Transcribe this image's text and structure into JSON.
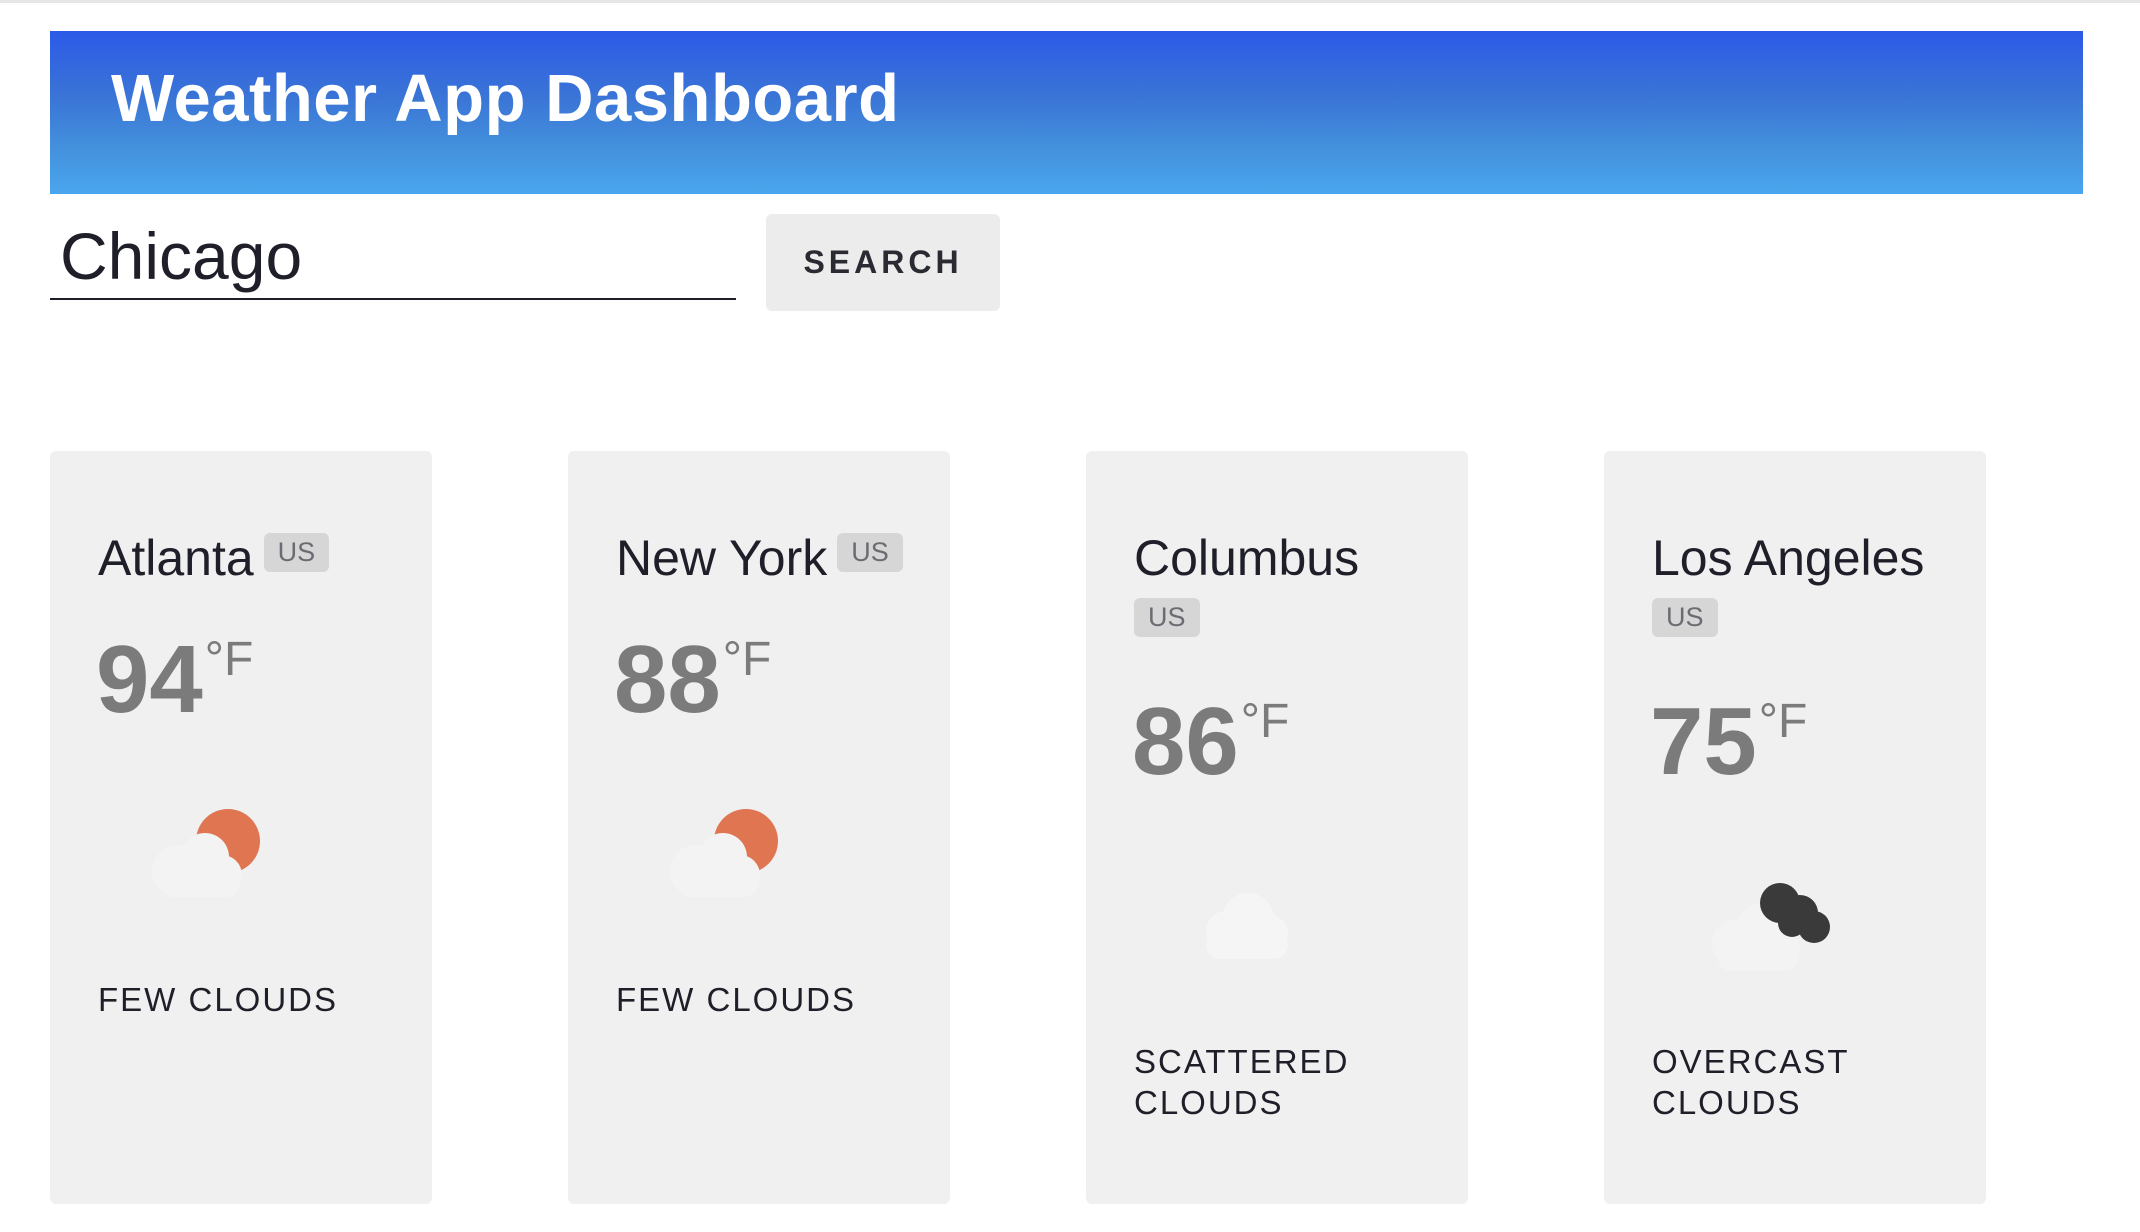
{
  "header": {
    "title": "Weather App Dashboard"
  },
  "search": {
    "value": "Chicago",
    "button_label": "SEARCH"
  },
  "cards": [
    {
      "city": "Atlanta",
      "country": "US",
      "temp": "94",
      "unit": "°F",
      "icon": "few-clouds-day-icon",
      "description": "FEW CLOUDS"
    },
    {
      "city": "New York",
      "country": "US",
      "temp": "88",
      "unit": "°F",
      "icon": "few-clouds-day-icon",
      "description": "FEW CLOUDS"
    },
    {
      "city": "Columbus",
      "country": "US",
      "temp": "86",
      "unit": "°F",
      "icon": "scattered-clouds-icon",
      "description": "SCATTERED CLOUDS"
    },
    {
      "city": "Los Angeles",
      "country": "US",
      "temp": "75",
      "unit": "°F",
      "icon": "overcast-clouds-icon",
      "description": "OVERCAST CLOUDS"
    }
  ],
  "colors": {
    "header_top": "#2c5ae8",
    "header_bottom": "#4aa6ee",
    "card_bg": "#f0f0f0",
    "sun": "#e07552",
    "dark_cloud": "#3a3a3a"
  }
}
